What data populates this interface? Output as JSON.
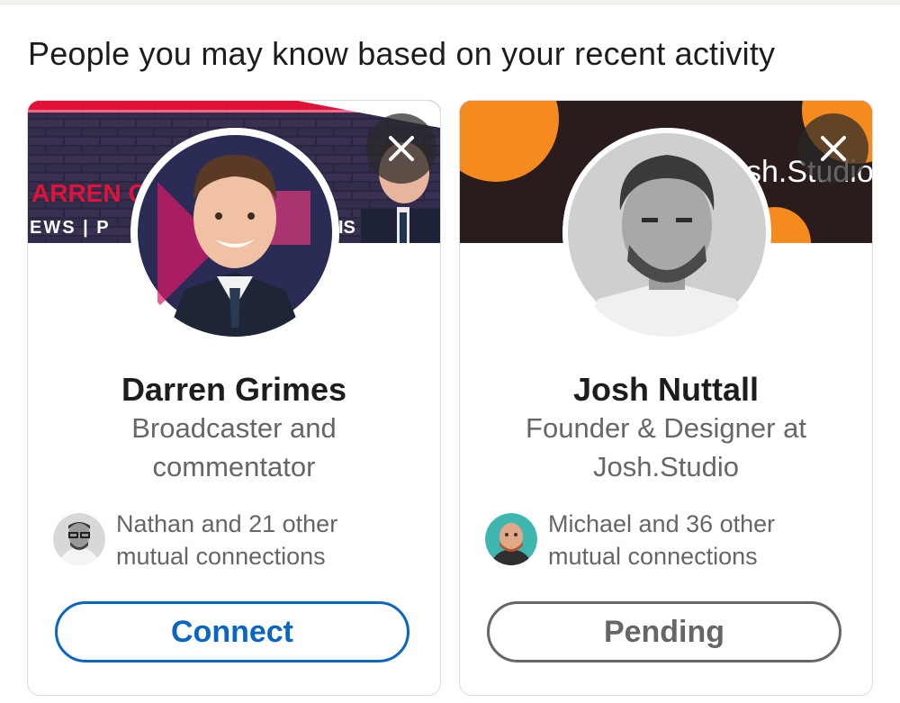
{
  "section": {
    "title": "People you may know based on your recent activity"
  },
  "colors": {
    "primary": "#0a66c2",
    "muted": "#666666",
    "text": "#1d1d1d"
  },
  "cards": [
    {
      "name": "Darren Grimes",
      "headline": "Broadcaster and commentator",
      "mutual": "Nathan and 21 other mutual connections",
      "action": "Connect",
      "action_state": "connect",
      "banner_text_top": "ARREN G",
      "banner_text_bottom": "EWS | P",
      "banner_text_right": "IS",
      "dismiss_icon": "close-icon"
    },
    {
      "name": "Josh Nuttall",
      "headline": "Founder & Designer at Josh.Studio",
      "mutual": "Michael and 36 other mutual connections",
      "action": "Pending",
      "action_state": "pending",
      "banner_text": "sh.Studio",
      "dismiss_icon": "close-icon"
    }
  ]
}
